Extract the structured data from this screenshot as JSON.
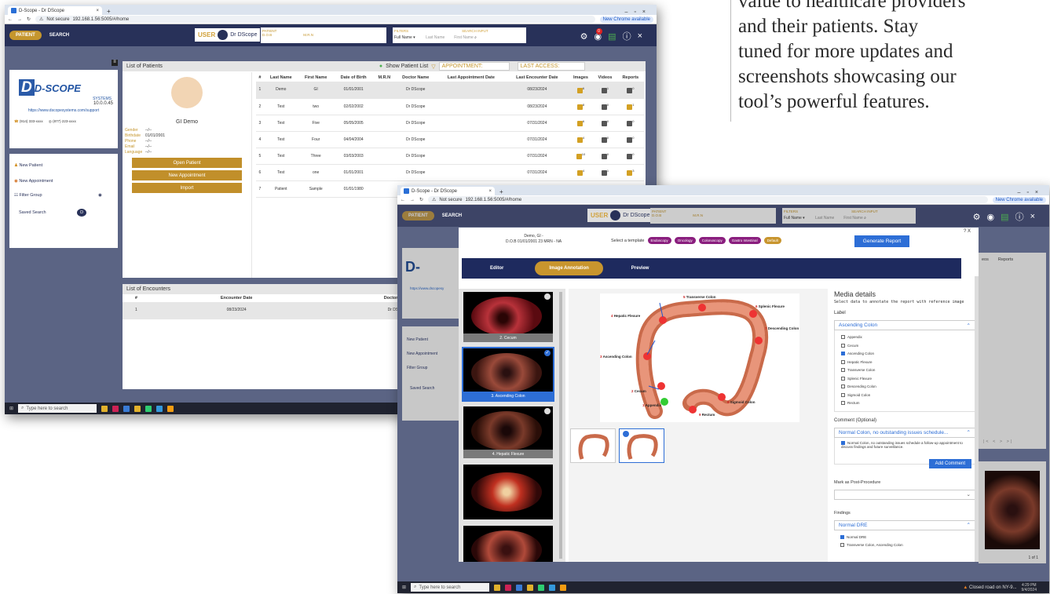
{
  "marketing_text": [
    "value to healthcare providers",
    "and their patients. Stay",
    "tuned for more updates and",
    "screenshots showcasing our",
    "tool’s powerful features."
  ],
  "back": {
    "tab_title": "D-Scope - Dr DScope",
    "url": "192.168.1.56:5005/#/home",
    "not_secure": "Not secure",
    "chrome_btn": "New Chrome available",
    "nav": {
      "patient": "PATIENT",
      "search": "SEARCH"
    },
    "user_label": "USER",
    "user_name": "Dr DScope",
    "patient_hdr": {
      "patient": "PATIENT",
      "dob": "D.O.B",
      "mrn": "M.R.N"
    },
    "filters": {
      "label": "FILTERS",
      "value": "Full Name",
      "search_input": "SEARCH INPUT",
      "last": "Last Name",
      "first": "First Name"
    },
    "badge": "0",
    "logo": {
      "brand": "D-SCOPE",
      "systems": "SYSTEMS",
      "version": "10.0.0.45",
      "url": "https://www.dscopesystems.com/support",
      "phone1": "(914) 333-xxxx",
      "phone2": "(877) 223-xxxx"
    },
    "side": {
      "new_patient": "New Patient",
      "new_appt": "New Appointment",
      "filter_group": "Filter Group",
      "saved_search": "Saved Search",
      "avatar_letter": "D"
    },
    "list_title": "List of Patients",
    "show_list": "Show Patient List",
    "appointment": "APPOINTMENT:",
    "last_access": "LAST ACCESS:",
    "patient_card": {
      "name": "GI Demo",
      "fields": [
        [
          "Gender",
          "--/--"
        ],
        [
          "Birthdate",
          "01/01/2001"
        ],
        [
          "Phone",
          "--/--"
        ],
        [
          "Email",
          "--/--"
        ],
        [
          "Language",
          "--/--"
        ]
      ],
      "open": "Open Patient",
      "new_appt": "New Appointment",
      "import": "Import"
    },
    "columns": [
      "#",
      "Last Name",
      "First Name",
      "Date of Birth",
      "M.R.N",
      "Doctor Name",
      "Last Appointment Date",
      "Last Encounter Date",
      "Images",
      "Videos",
      "Reports"
    ],
    "rows": [
      [
        "1",
        "Demo",
        "GI",
        "01/01/2001",
        "",
        "Dr DScope",
        "",
        "08/23/2024",
        "6",
        "1",
        "0"
      ],
      [
        "2",
        "Test",
        "two",
        "02/02/2002",
        "",
        "Dr DScope",
        "",
        "08/23/2024",
        "8",
        "0",
        "1"
      ],
      [
        "3",
        "Test",
        "Five",
        "05/05/2005",
        "",
        "Dr DScope",
        "",
        "07/31/2024",
        "6",
        "0",
        "0"
      ],
      [
        "4",
        "Test",
        "Four",
        "04/04/2004",
        "",
        "Dr DScope",
        "",
        "07/31/2024",
        "4",
        "0",
        "0"
      ],
      [
        "5",
        "Test",
        "Three",
        "03/03/2003",
        "",
        "Dr DScope",
        "",
        "07/31/2024",
        "10",
        "0",
        "0"
      ],
      [
        "6",
        "Test",
        "one",
        "01/01/2001",
        "",
        "Dr DScope",
        "",
        "07/31/2024",
        "4",
        "1",
        "3"
      ],
      [
        "7",
        "Patient",
        "Sample",
        "01/01/1980",
        "",
        "Dr DScope",
        "",
        "",
        "",
        "",
        ""
      ]
    ],
    "enc_title": "List of Encounters",
    "enc_columns": [
      "#",
      "Encounter Date",
      "Doctor Name",
      "Images",
      "Videos"
    ],
    "enc_rows": [
      [
        "1",
        "08/23/2024",
        "Dr DScope",
        "6",
        "1"
      ]
    ],
    "taskbar_search": "Type here to search"
  },
  "front": {
    "tab_title": "D-Scope - Dr DScope",
    "url": "192.168.1.56:5005/#/home",
    "not_secure": "Not secure",
    "chrome_btn": "New Chrome available",
    "patient_info": [
      "Demo, GI -",
      "D.O.B 01/01/2001 23 MRN - NA"
    ],
    "select_template": "Select a template",
    "templates": [
      "Endoscopy",
      "Oncology",
      "Colonoscopy",
      "Gastro Intestinal",
      "Default"
    ],
    "generate": "Generate Report",
    "close": "? X",
    "tabs": [
      "Editor",
      "Image Annotation",
      "Preview"
    ],
    "thumbs": [
      "2. Cecum",
      "3. Ascending Colon",
      "4. Hepatic Flexure"
    ],
    "diagram_labels": [
      {
        "n": "1",
        "t": "Appendix"
      },
      {
        "n": "2",
        "t": "Cecum"
      },
      {
        "n": "3",
        "t": "Ascending Colon"
      },
      {
        "n": "4",
        "t": "Hepatic Flexure"
      },
      {
        "n": "5",
        "t": "Transverse Colon"
      },
      {
        "n": "6",
        "t": "Splenic Flexure"
      },
      {
        "n": "7",
        "t": "Descending Colon"
      },
      {
        "n": "8",
        "t": "Sigmoid Colon"
      },
      {
        "n": "9",
        "t": "Rectum"
      }
    ],
    "media": {
      "title": "Media details",
      "desc": "Select data to annotate the report with reference image",
      "label": "Label",
      "selected": "Ascending Colon",
      "options": [
        {
          "t": "Appendix",
          "on": false
        },
        {
          "t": "Cecum",
          "on": false
        },
        {
          "t": "Ascending Colon",
          "on": true
        },
        {
          "t": "Hepatic Flexure",
          "on": false
        },
        {
          "t": "Transverse Colon",
          "on": false
        },
        {
          "t": "Splenic Flexure",
          "on": false
        },
        {
          "t": "Descending Colon",
          "on": false
        },
        {
          "t": "Sigmoid Colon",
          "on": false
        },
        {
          "t": "Rectum",
          "on": false
        }
      ],
      "comment_label": "Comment (Optional)",
      "comment_sel": "Normal Colon, no outstanding issues schedule...",
      "comment_text": "Normal Colon, no outstanding issues schedule a follow-up appointment to discuss findings and future surveillance.",
      "add_comment": "Add Comment",
      "post_label": "Mark as Post-Procedure",
      "findings_label": "Findings",
      "findings_sel": "Normal DRE",
      "findings_opts": [
        {
          "t": "Normal DRE",
          "on": true
        },
        {
          "t": "Transverse Colon, Ascending Colon",
          "on": false
        }
      ]
    },
    "bg": {
      "videos": "eos",
      "reports": "Reports",
      "pager": "|< < > >|",
      "url2": "https://www.dscopesy",
      "new_patient": "New Patient",
      "new_appt": "New Appointment",
      "filter_group": "Filter Group",
      "saved_search": "Saved Search",
      "of": "1 of 1"
    },
    "taskbar": {
      "search": "Type here to search",
      "weather": "Closed road on NY-9...",
      "time": "4:29 PM",
      "date": "9/4/2024"
    }
  }
}
